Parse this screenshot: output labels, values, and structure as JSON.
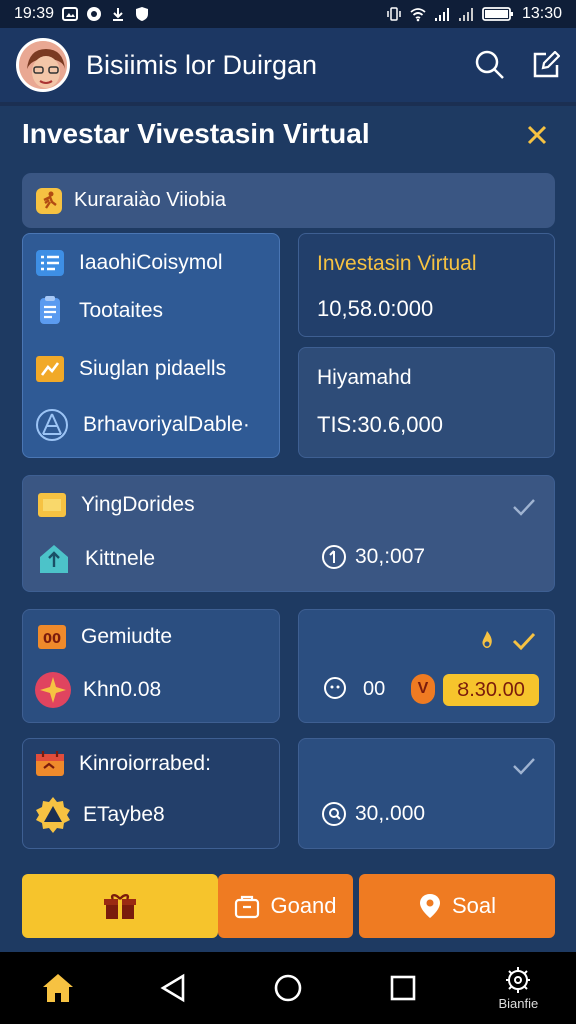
{
  "status_bar": {
    "time_left": "19:39",
    "time_right": "13:30"
  },
  "header": {
    "title": "Bisiimis lor Duirgan",
    "icons": [
      "search-icon",
      "edit-icon"
    ]
  },
  "panel": {
    "title": "Investar Vivestasin Virtual",
    "subtitle": "Kuraraiào Viiobia"
  },
  "menu_card": {
    "items": [
      {
        "label": "IaaohiCoisymol",
        "icon": "list-icon"
      },
      {
        "label": "Tootaites",
        "icon": "document-icon"
      },
      {
        "label": "Siuglan pidaells",
        "icon": "chart-icon"
      },
      {
        "label": "BrhavoriyalDable·",
        "icon": "network-icon"
      }
    ]
  },
  "investasin_card": {
    "label": "Investasin Virtual",
    "value": "10,58.0:000"
  },
  "hiyamahd_card": {
    "label": "Hiyamahd",
    "value": "TIS:30.6,000"
  },
  "yingdorides_card": {
    "title": "YingDorides",
    "item_label": "Kittnele",
    "amount": "30,:007"
  },
  "gemiudte_card": {
    "title": "Gemiudte",
    "value": "Khn0.08"
  },
  "right_card_1": {
    "small_amount": "00",
    "badge": "V",
    "pill": "Ȣ.30.00"
  },
  "kinroiorrabed_card": {
    "title": "Kinroiorrabed:",
    "value": "ETaybe8"
  },
  "right_card_2": {
    "amount": "30,.000"
  },
  "actions": {
    "button_2": "Goand",
    "button_3": "Soal"
  },
  "navbar": {
    "settings_label": "Bianfie"
  },
  "colors": {
    "accent_yellow": "#f6c242",
    "accent_orange": "#ef7b22",
    "panel_bg": "#1e3a62",
    "card_bg": "#2d4b79"
  }
}
